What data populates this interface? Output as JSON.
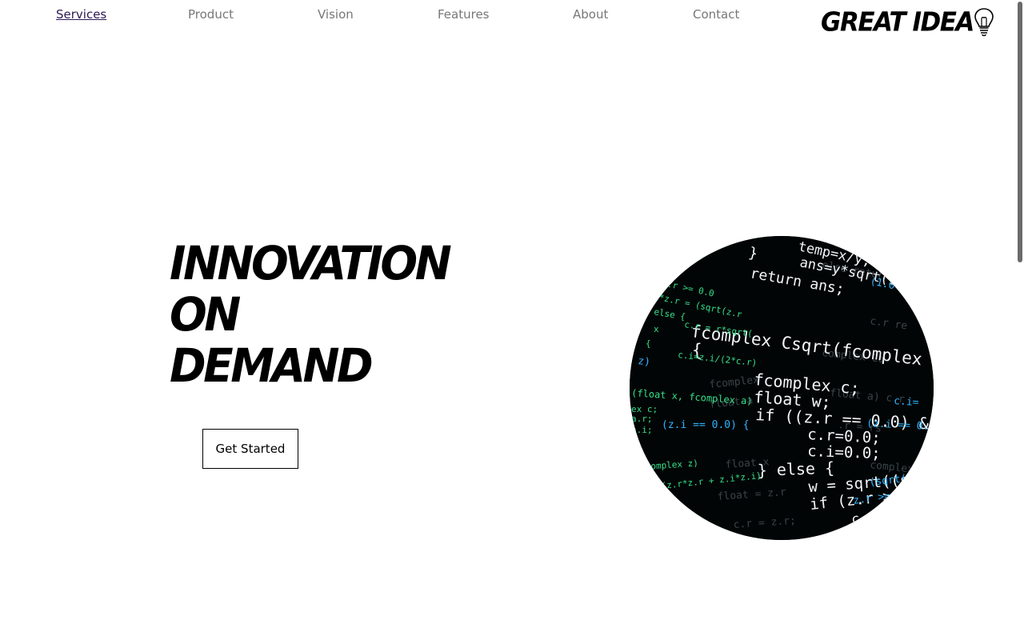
{
  "nav": {
    "items": [
      {
        "label": "Services",
        "active": true
      },
      {
        "label": "Product",
        "active": false
      },
      {
        "label": "Vision",
        "active": false
      },
      {
        "label": "Features",
        "active": false
      },
      {
        "label": "About",
        "active": false
      },
      {
        "label": "Contact",
        "active": false
      }
    ],
    "brand": "GREAT IDEA",
    "brand_icon": "lightbulb-icon"
  },
  "hero": {
    "headline": [
      "INNOVATION",
      "ON",
      "DEMAND"
    ],
    "cta_label": "Get Started",
    "image_icon": "code-screen-image"
  },
  "colors": {
    "nav_text": "#777777",
    "nav_active": "#2c1a55",
    "text": "#000000",
    "code_bg": "#020506",
    "code_white": "#f2f6f8",
    "code_green": "#35e08a",
    "code_blue": "#2fb4ff",
    "code_dim": "#3a4448"
  }
}
